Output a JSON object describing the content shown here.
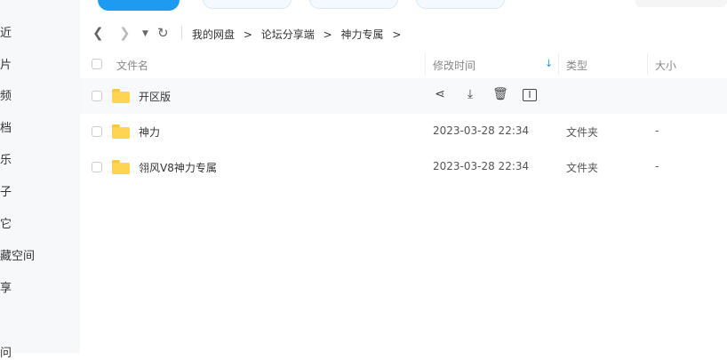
{
  "sidebar": {
    "items": [
      {
        "label": "近"
      },
      {
        "label": "片"
      },
      {
        "label": "频"
      },
      {
        "label": "档"
      },
      {
        "label": "乐"
      },
      {
        "label": "子"
      },
      {
        "label": "它"
      },
      {
        "label": "藏空间"
      },
      {
        "label": "享"
      },
      {
        "label": "问"
      }
    ]
  },
  "breadcrumb": {
    "items": [
      "我的网盘",
      "论坛分享端",
      "神力专属"
    ],
    "separator": ">"
  },
  "table": {
    "columns": {
      "name": "文件名",
      "modified": "修改时间",
      "type": "类型",
      "size": "大小"
    },
    "rows": [
      {
        "name": "开区版",
        "modified": "",
        "type": "",
        "size": ""
      },
      {
        "name": "神力",
        "modified": "2023-03-28 22:34",
        "type": "文件夹",
        "size": "-"
      },
      {
        "name": "翎风V8神力专属",
        "modified": "2023-03-28 22:34",
        "type": "文件夹",
        "size": "-"
      }
    ]
  },
  "colors": {
    "accent": "#1e9bf0",
    "folder": "#ffd452",
    "sort_arrow": "#1e9bf0"
  }
}
